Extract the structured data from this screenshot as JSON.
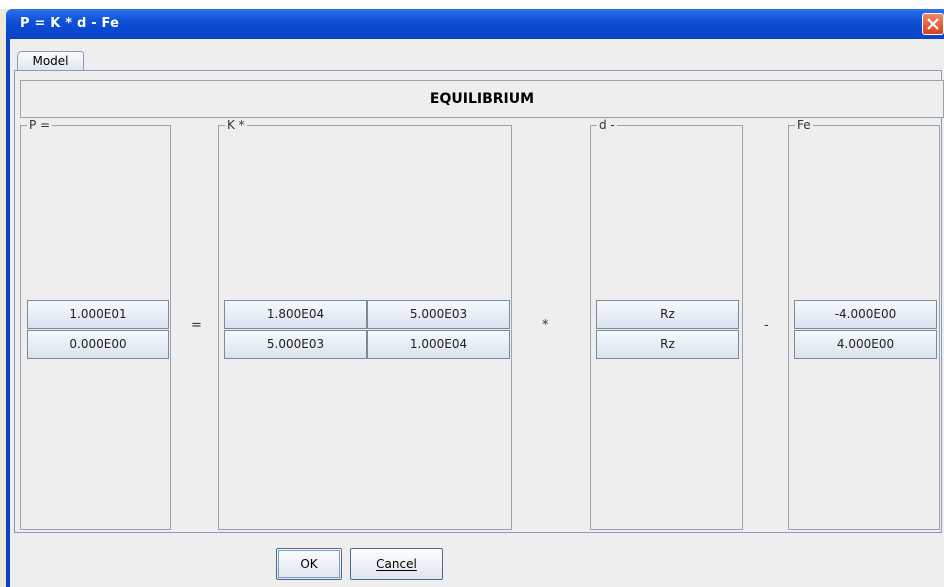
{
  "window": {
    "title": "P = K * d - Fe"
  },
  "tabs": [
    {
      "label": "Model"
    }
  ],
  "header": {
    "title": "EQUILIBRIUM"
  },
  "groups": {
    "p": {
      "label": "P =",
      "values": [
        "1.000E01",
        "0.000E00"
      ]
    },
    "k": {
      "label": "K *",
      "values": [
        [
          "1.800E04",
          "5.000E03"
        ],
        [
          "5.000E03",
          "1.000E04"
        ]
      ]
    },
    "d": {
      "label": "d -",
      "values": [
        "Rz",
        "Rz"
      ]
    },
    "fe": {
      "label": "Fe",
      "values": [
        "-4.000E00",
        "4.000E00"
      ]
    }
  },
  "operators": {
    "equals": "=",
    "times": "*",
    "minus": "-"
  },
  "buttons": {
    "ok": "OK",
    "cancel": "Cancel"
  },
  "colors": {
    "titlebar": "#0b44c2",
    "close": "#d5401d",
    "panel": "#eeeeee"
  }
}
